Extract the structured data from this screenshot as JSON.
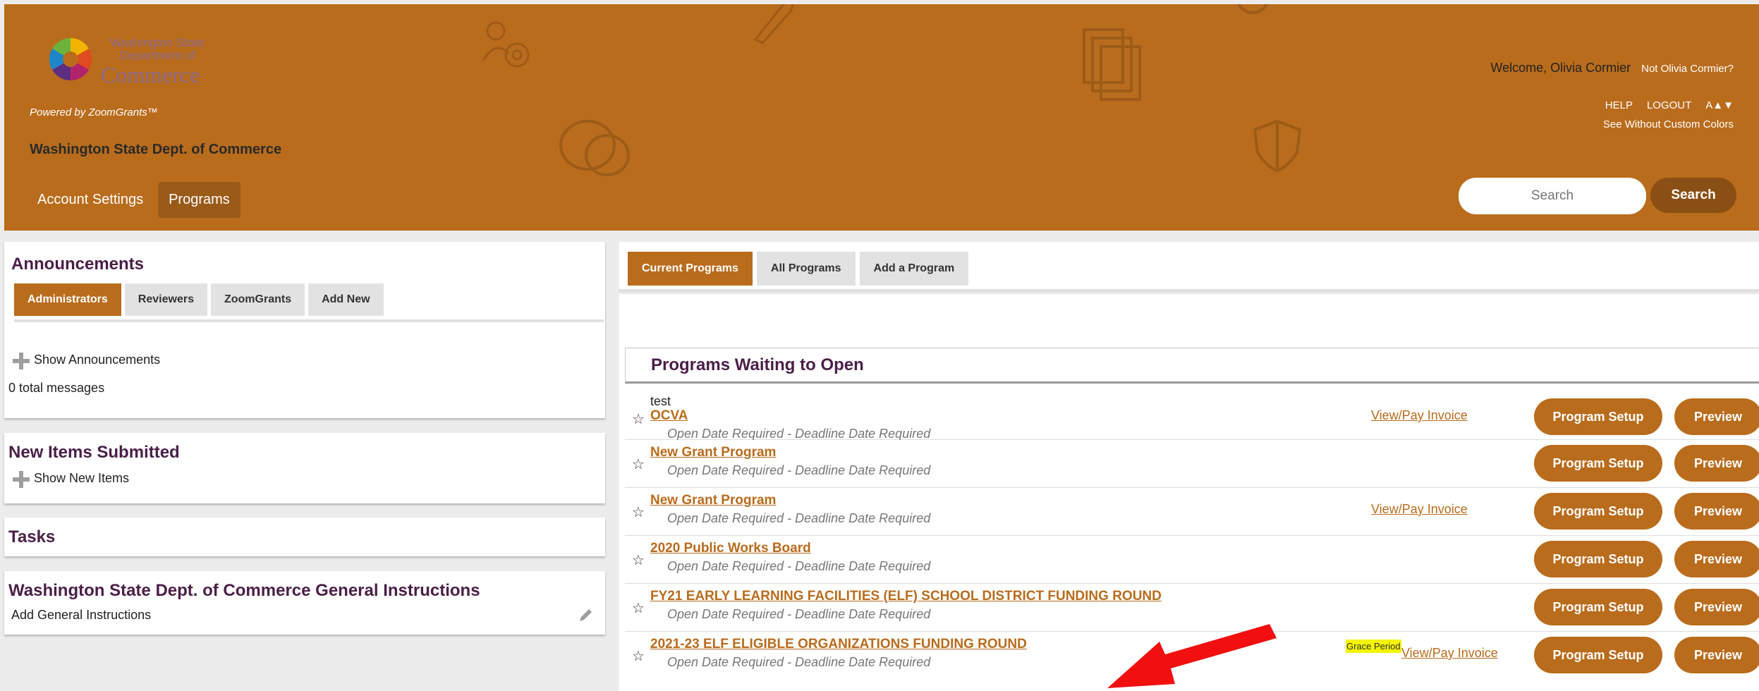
{
  "header": {
    "logo_line1": "Washington State",
    "logo_line2": "Department of",
    "logo_line3": "Commerce",
    "powered_by": "Powered by ZoomGrants™",
    "org_name": "Washington State Dept. of Commerce",
    "nav": [
      {
        "label": "Account Settings",
        "active": false
      },
      {
        "label": "Programs",
        "active": true
      }
    ],
    "welcome": "Welcome, Olivia Cormier",
    "not_user": "Not Olivia Cormier?",
    "help": "HELP",
    "logout": "LOGOUT",
    "text_size": "A▲▼",
    "custom_colors": "See Without Custom Colors",
    "search_placeholder": "Search",
    "search_button": "Search",
    "brand_color": "#b96c1c"
  },
  "announcements": {
    "title": "Announcements",
    "tabs": [
      "Administrators",
      "Reviewers",
      "ZoomGrants",
      "Add New"
    ],
    "active_tab": "Administrators",
    "show_label": "Show Announcements",
    "count_text": "0 total messages"
  },
  "new_items": {
    "title": "New Items Submitted",
    "show_label": "Show New Items"
  },
  "tasks": {
    "title": "Tasks"
  },
  "instructions": {
    "title": "Washington State Dept. of Commerce General Instructions",
    "add_label": "Add General Instructions"
  },
  "programs_tabs": [
    "Current Programs",
    "All Programs",
    "Add a Program"
  ],
  "programs_active_tab": "Current Programs",
  "section_title": "Programs Waiting to Open",
  "programs": [
    {
      "prefix": "test",
      "name": "OCVA",
      "status": "Open Date Required - Deadline Date Required",
      "invoice": "View/Pay Invoice",
      "grace": ""
    },
    {
      "prefix": "",
      "name": "New Grant Program",
      "status": "Open Date Required - Deadline Date Required",
      "invoice": "",
      "grace": ""
    },
    {
      "prefix": "",
      "name": "New Grant Program",
      "status": "Open Date Required - Deadline Date Required",
      "invoice": "View/Pay Invoice",
      "grace": ""
    },
    {
      "prefix": "",
      "name": "2020 Public Works Board",
      "status": "Open Date Required - Deadline Date Required",
      "invoice": "",
      "grace": ""
    },
    {
      "prefix": "",
      "name": "FY21 EARLY LEARNING FACILITIES (ELF) SCHOOL DISTRICT FUNDING ROUND",
      "status": "Open Date Required - Deadline Date Required",
      "invoice": "",
      "grace": ""
    },
    {
      "prefix": "",
      "name": "2021-23 ELF ELIGIBLE ORGANIZATIONS FUNDING ROUND",
      "status": "Open Date Required - Deadline Date Required",
      "invoice": "View/Pay Invoice",
      "grace": "Grace Period"
    }
  ],
  "program_setup_label": "Program Setup",
  "preview_label": "Preview",
  "star_glyph": "☆"
}
